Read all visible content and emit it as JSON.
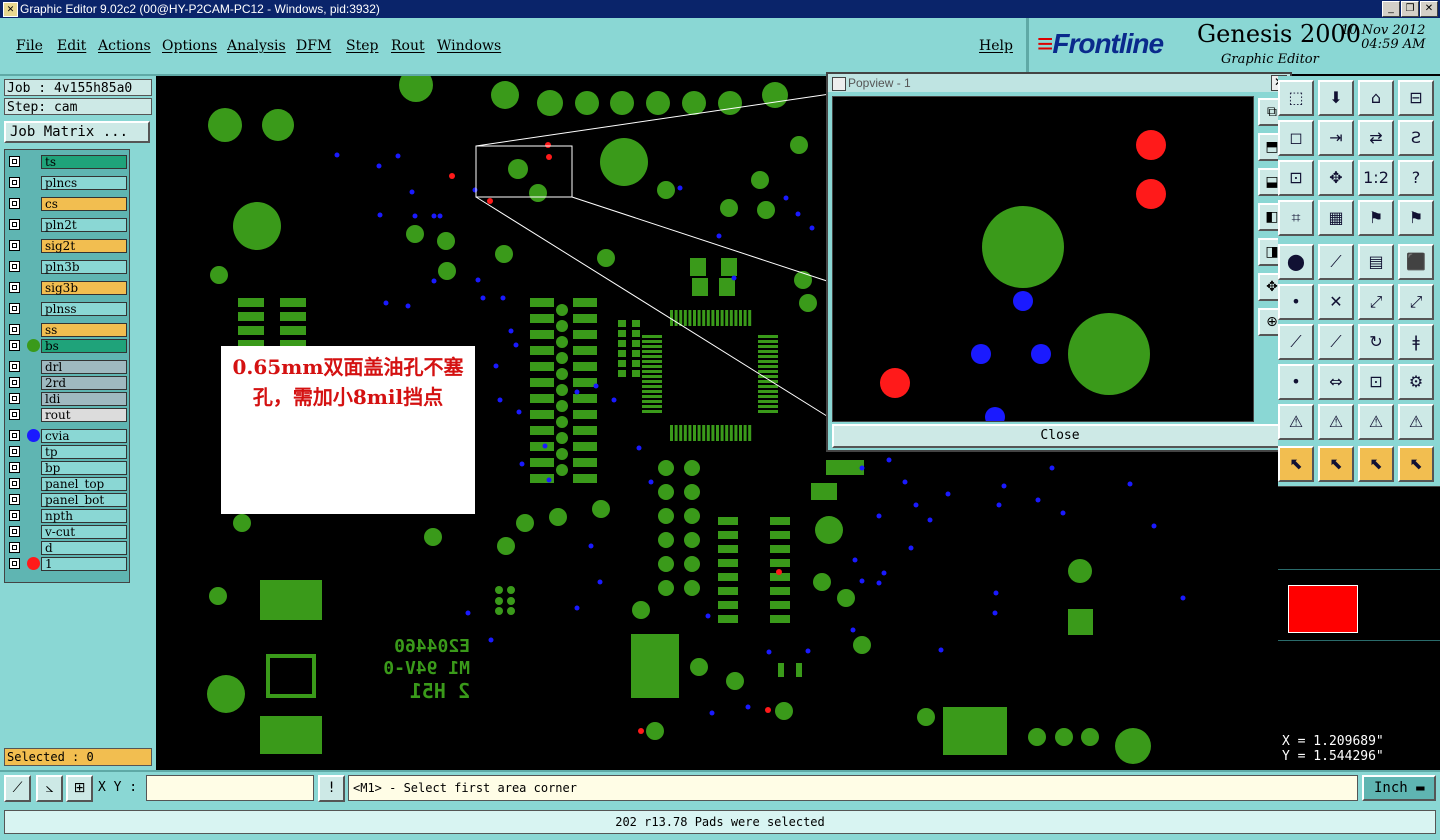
{
  "window": {
    "title": "Graphic Editor 9.02c2 (00@HY-P2CAM-PC12 - Windows, pid:3932)"
  },
  "menu": {
    "items": [
      "File",
      "Edit",
      "Actions",
      "Options",
      "Analysis",
      "DFM",
      "Step",
      "Rout",
      "Windows"
    ],
    "help": "Help"
  },
  "brand": {
    "logo": "Frontline",
    "product": "Genesis 2000",
    "subtitle": "Graphic Editor",
    "date": "10 Nov 2012",
    "time": "04:59 AM"
  },
  "job": {
    "job_line": "Job : 4v155h85a0",
    "step_line": "Step: cam",
    "matrix_button": "Job Matrix ..."
  },
  "layers": [
    {
      "name": "ts",
      "color": "#1fa37a",
      "dot": ""
    },
    {
      "name": "plncs",
      "color": "#8ad7d4",
      "dot": ""
    },
    {
      "name": "cs",
      "color": "#f2be50",
      "dot": ""
    },
    {
      "name": "pln2t",
      "color": "#8ad7d4",
      "dot": ""
    },
    {
      "name": "sig2t",
      "color": "#f2be50",
      "dot": ""
    },
    {
      "name": "pln3b",
      "color": "#8ad7d4",
      "dot": ""
    },
    {
      "name": "sig3b",
      "color": "#f2be50",
      "dot": ""
    },
    {
      "name": "plnss",
      "color": "#8ad7d4",
      "dot": ""
    },
    {
      "name": "ss",
      "color": "#f2be50",
      "dot": ""
    },
    {
      "name": "bs",
      "color": "#1fa37a",
      "dot": "#3a9a1a"
    },
    {
      "name": "drl",
      "color": "#9fb9c0",
      "dot": ""
    },
    {
      "name": "2rd",
      "color": "#9fb9c0",
      "dot": ""
    },
    {
      "name": "ldi",
      "color": "#9fb9c0",
      "dot": ""
    },
    {
      "name": "rout",
      "color": "#dcdcdc",
      "dot": ""
    },
    {
      "name": "cvia",
      "color": "#8ad7d4",
      "dot": "#1a1aff"
    },
    {
      "name": "tp",
      "color": "#8ad7d4",
      "dot": ""
    },
    {
      "name": "bp",
      "color": "#8ad7d4",
      "dot": ""
    },
    {
      "name": "panel_top",
      "color": "#8ad7d4",
      "dot": ""
    },
    {
      "name": "panel_bot",
      "color": "#8ad7d4",
      "dot": ""
    },
    {
      "name": "npth",
      "color": "#8ad7d4",
      "dot": ""
    },
    {
      "name": "v-cut",
      "color": "#8ad7d4",
      "dot": ""
    },
    {
      "name": "d",
      "color": "#8ad7d4",
      "dot": ""
    },
    {
      "name": "1",
      "color": "#8ad7d4",
      "dot": "#ff1a1a"
    }
  ],
  "selected": "Selected : 0",
  "annotation": {
    "text": "0.65mm双面盖油孔不塞孔，需加小8mil挡点"
  },
  "popview": {
    "title": "Popview - 1",
    "close": "Close",
    "close_x": "✕"
  },
  "coords": {
    "x": "X = 1.209689\"",
    "y": "Y = 1.544296\""
  },
  "bottom": {
    "xy_label": "X Y :",
    "prompt": "<M1> - Select first area corner",
    "units": "Inch"
  },
  "status": "202 r13.78 Pads were selected",
  "board_text": {
    "line1": "E204460",
    "line2": "M1 94V-0",
    "line3": "2 H51"
  },
  "colors": {
    "pad": "#3a9a1a",
    "via": "#1a1aff",
    "drill": "#ff1a1a"
  }
}
